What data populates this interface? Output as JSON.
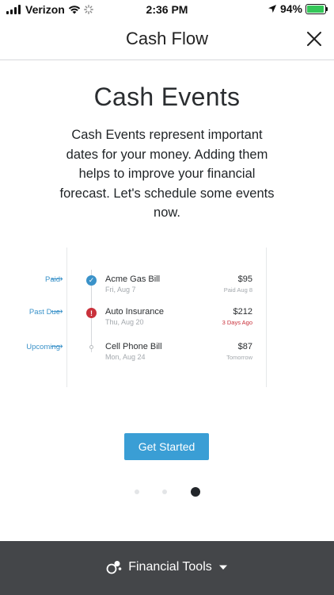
{
  "status_bar": {
    "carrier": "Verizon",
    "time": "2:36 PM",
    "battery": "94%",
    "battery_level": 0.94
  },
  "header": {
    "title": "Cash Flow",
    "close_icon": "close-icon"
  },
  "intro": {
    "title": "Cash Events",
    "text": "Cash Events represent important dates for your money. Adding them helps to improve your financial forecast. Let's schedule some events now."
  },
  "events": [
    {
      "status": "Paid",
      "name": "Acme Gas Bill",
      "date": "Fri, Aug 7",
      "amount": "$95",
      "sub": "Paid Aug 8",
      "sub_color": "#a3a8ad",
      "dot": "paid"
    },
    {
      "status": "Past Due",
      "name": "Auto Insurance",
      "date": "Thu, Aug 20",
      "amount": "$212",
      "sub": "3 Days Ago",
      "sub_color": "#c9313b",
      "dot": "pastdue"
    },
    {
      "status": "Upcoming",
      "name": "Cell Phone Bill",
      "date": "Mon, Aug 24",
      "amount": "$87",
      "sub": "Tomorrow",
      "sub_color": "#a3a8ad",
      "dot": "upcoming"
    }
  ],
  "cta": {
    "label": "Get Started",
    "color": "#3a9ed5"
  },
  "pager": {
    "count": 3,
    "active_index": 2
  },
  "bottom_bar": {
    "label": "Financial Tools",
    "icon": "financial-tools-icon"
  },
  "colors": {
    "accent": "#3a92c9",
    "danger": "#c9313b",
    "bottom_bar": "#444649"
  }
}
